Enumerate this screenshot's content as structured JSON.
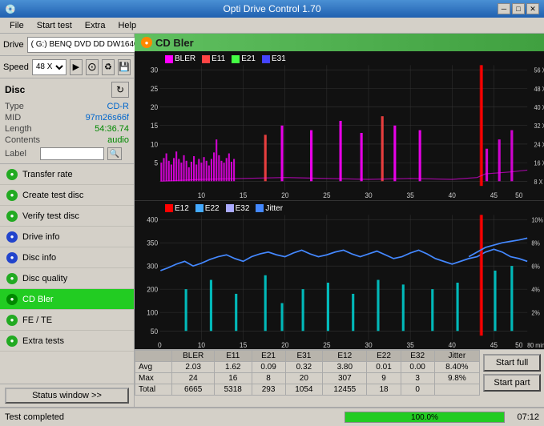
{
  "titleBar": {
    "icon": "💿",
    "title": "Opti Drive Control 1.70",
    "minBtn": "─",
    "maxBtn": "□",
    "closeBtn": "✕"
  },
  "menuBar": {
    "items": [
      "File",
      "Start test",
      "Extra",
      "Help"
    ]
  },
  "driveRow": {
    "label": "Drive",
    "driveValue": "(G:)  BENQ DVD DD DW1640 BSRB",
    "speedLabel": "Speed",
    "speedValue": "48 X"
  },
  "disc": {
    "title": "Disc",
    "type": {
      "label": "Type",
      "value": "CD-R"
    },
    "mid": {
      "label": "MID",
      "value": "97m26s66f"
    },
    "length": {
      "label": "Length",
      "value": "54:36.74"
    },
    "contents": {
      "label": "Contents",
      "value": "audio"
    },
    "label": {
      "label": "Label",
      "value": ""
    }
  },
  "navItems": [
    {
      "id": "transfer-rate",
      "label": "Transfer rate",
      "active": false
    },
    {
      "id": "create-test-disc",
      "label": "Create test disc",
      "active": false
    },
    {
      "id": "verify-test-disc",
      "label": "Verify test disc",
      "active": false
    },
    {
      "id": "drive-info",
      "label": "Drive info",
      "active": false
    },
    {
      "id": "disc-info",
      "label": "Disc info",
      "active": false
    },
    {
      "id": "disc-quality",
      "label": "Disc quality",
      "active": false
    },
    {
      "id": "cd-bler",
      "label": "CD Bler",
      "active": true
    },
    {
      "id": "fe-te",
      "label": "FE / TE",
      "active": false
    },
    {
      "id": "extra-tests",
      "label": "Extra tests",
      "active": false
    }
  ],
  "statusWindow": "Status window >>",
  "chart": {
    "title": "CD Bler",
    "topLegend": [
      {
        "label": "BLER",
        "color": "#ff00ff"
      },
      {
        "label": "E11",
        "color": "#ff4444"
      },
      {
        "label": "E21",
        "color": "#44ff44"
      },
      {
        "label": "E31",
        "color": "#4444ff"
      }
    ],
    "bottomLegend": [
      {
        "label": "E12",
        "color": "#ff0000"
      },
      {
        "label": "E22",
        "color": "#44aaff"
      },
      {
        "label": "E32",
        "color": "#aaaaff"
      },
      {
        "label": "Jitter",
        "color": "#4488ff"
      }
    ]
  },
  "statsTable": {
    "headers": [
      "",
      "BLER",
      "E11",
      "E21",
      "E31",
      "E12",
      "E22",
      "E32",
      "Jitter",
      ""
    ],
    "rows": [
      {
        "label": "Avg",
        "values": [
          "2.03",
          "1.62",
          "0.09",
          "0.32",
          "3.80",
          "0.01",
          "0.00",
          "8.40%"
        ]
      },
      {
        "label": "Max",
        "values": [
          "24",
          "16",
          "8",
          "20",
          "307",
          "9",
          "3",
          "9.8%"
        ]
      },
      {
        "label": "Total",
        "values": [
          "6665",
          "5318",
          "293",
          "1054",
          "12455",
          "18",
          "0",
          ""
        ]
      }
    ],
    "buttons": [
      "Start full",
      "Start part"
    ]
  },
  "statusBar": {
    "text": "Test completed",
    "progress": "100.0%",
    "progressValue": 100,
    "time": "07:12"
  }
}
